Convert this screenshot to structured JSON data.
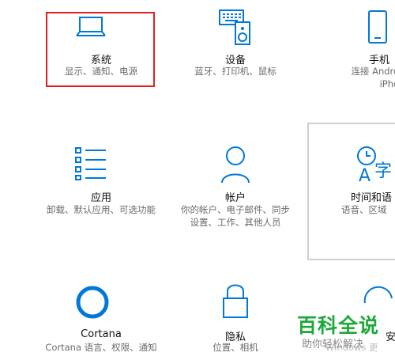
{
  "tiles": {
    "system": {
      "title": "系统",
      "desc": [
        "显示、通知、电源"
      ]
    },
    "devices": {
      "title": "设备",
      "desc": [
        "蓝牙、打印机、鼠标"
      ]
    },
    "phone": {
      "title": "手机",
      "desc": [
        "连接 Android",
        "iPhone"
      ]
    },
    "apps": {
      "title": "应用",
      "desc": [
        "卸载、默认应用、可选功能"
      ]
    },
    "accounts": {
      "title": "帐户",
      "desc": [
        "你的帐户、电子邮件、同步",
        "设置、工作、其他人员"
      ]
    },
    "time": {
      "title": "时间和语",
      "desc": [
        "语音、区域"
      ]
    },
    "cortana": {
      "title": "Cortana",
      "desc": [
        "Cortana 语言、权限、通知"
      ]
    },
    "privacy": {
      "title": "隐私",
      "desc": [
        "位置、相机"
      ]
    },
    "security": {
      "title": "安",
      "desc": [
        "Windows 更"
      ]
    }
  },
  "watermark": {
    "brand": "百科全说",
    "tagline": "助你轻松解决"
  },
  "colors": {
    "accent": "#0078d7",
    "highlight": "#e02020",
    "watermark_green": "#1fa83a"
  }
}
